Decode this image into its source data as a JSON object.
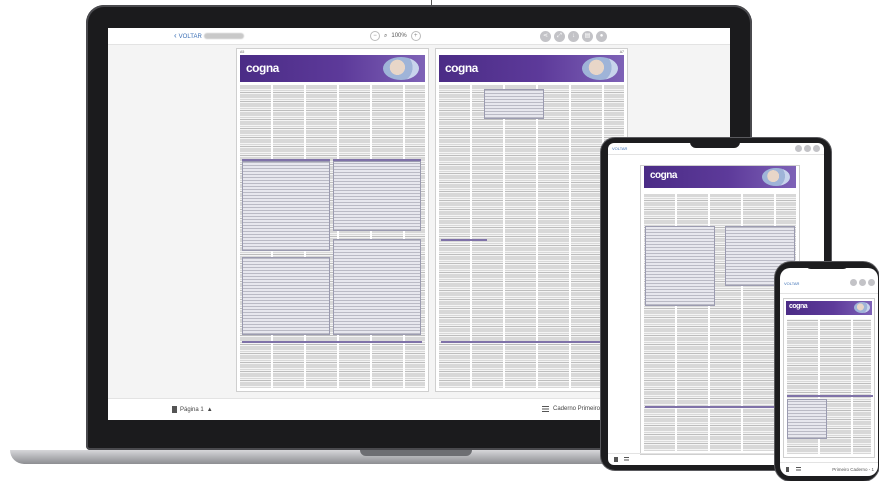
{
  "laptop": {
    "toolbar": {
      "back_label": "VOLTAR",
      "zoom_level": "100%",
      "zoom_out": "−",
      "zoom_in": "+",
      "action_icons": [
        "share-icon",
        "fullscreen-icon",
        "download-icon",
        "print-icon",
        "user-icon"
      ]
    },
    "bottombar": {
      "page_label": "Página 1",
      "page_arrow": "▲",
      "caderno_label": "Caderno Primeiro Cade"
    },
    "pages": [
      {
        "logo": "cogna",
        "number": "A5"
      },
      {
        "logo": "cogna",
        "number": "A7"
      }
    ]
  },
  "tablet": {
    "back_label": "VOLTAR",
    "logo": "cogna"
  },
  "phone": {
    "back_label": "VOLTAR",
    "logo": "cogna",
    "caderno_label": "Primeiro Caderno - 1"
  },
  "colors": {
    "banner": "#4b2c86",
    "accent_link": "#3b6fb5"
  }
}
